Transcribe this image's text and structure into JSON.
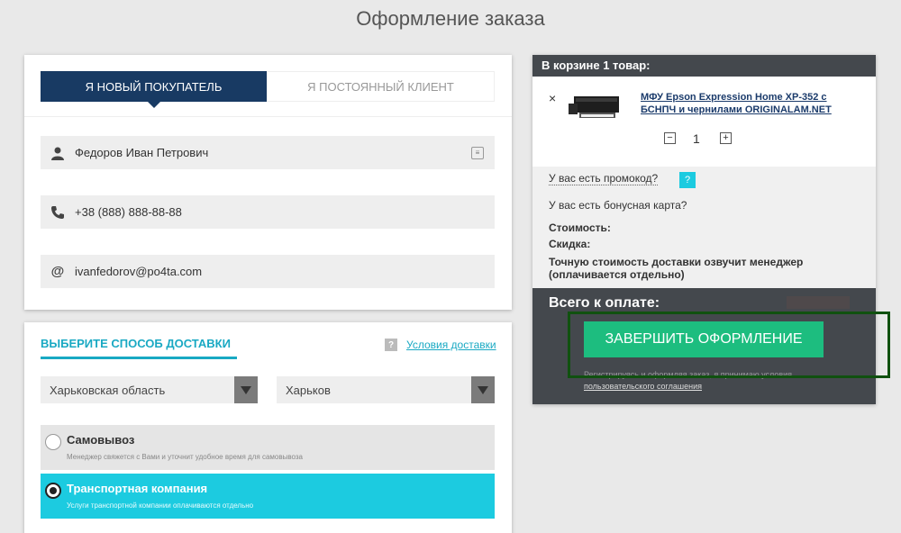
{
  "page": {
    "title": "Оформление заказа"
  },
  "customer": {
    "tabs": [
      {
        "label": "Я новый покупатель",
        "active": true
      },
      {
        "label": "Я постоянный клиент",
        "active": false
      }
    ],
    "fields": {
      "name": {
        "value": "Федоров Иван Петрович",
        "icon": "user-icon"
      },
      "phone": {
        "value": "+38 (888) 888-88-88",
        "icon": "phone-icon"
      },
      "email": {
        "value": "ivanfedorov@po4ta.com",
        "icon": "at-icon"
      }
    }
  },
  "delivery": {
    "title": "Выберите способ доставки",
    "terms_link": "Условия доставки",
    "region": "Харьковская область",
    "city": "Харьков",
    "options": [
      {
        "name": "Самовывоз",
        "description": "Менеджер свяжется с Вами и уточнит удобное время для самовывоза",
        "selected": false
      },
      {
        "name": "Транспортная компания",
        "description": "Услуги транспортной компании оплачиваются отдельно",
        "selected": true
      }
    ]
  },
  "cart": {
    "header": "В корзине 1 товар:",
    "item": {
      "name": "МФУ Epson Expression Home XP-352 с БСНПЧ и чернилами ORIGINALAM.NET",
      "quantity": "1",
      "minus": "−",
      "plus": "+",
      "remove": "×"
    },
    "promo": "У вас есть промокод?",
    "promo_help": "?",
    "bonus": "У вас есть бонусная карта?",
    "cost_label": "Стоимость:",
    "discount_label": "Скидка:",
    "shipping_note": "Точную стоимость доставки озвучит менеджер (оплачивается отдельно)",
    "total_label": "Всего к оплате:",
    "finish_button": "Завершить оформление",
    "agreement_text": "Регистрируясь и оформляя заказ, я принимаю условия",
    "agreement_link": "пользовательского соглашения"
  },
  "colors": {
    "accent": "#19a9c3",
    "active_tab": "#183a63",
    "selected_option": "#1ccbe0",
    "finish_button": "#1dbd7f",
    "cart_dark": "#44484d",
    "highlight_box": "#10510f"
  }
}
